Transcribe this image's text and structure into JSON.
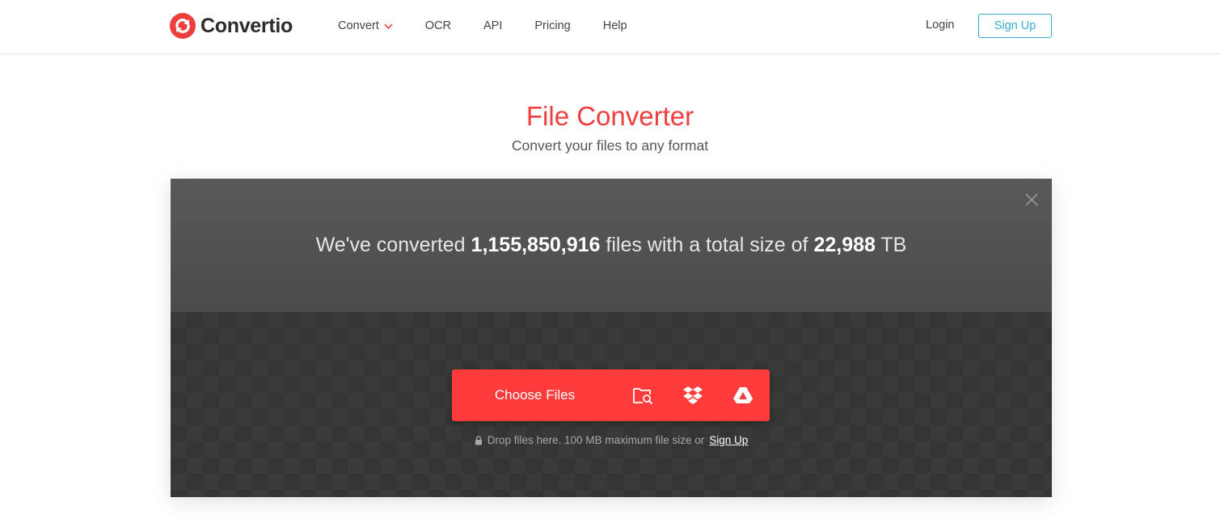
{
  "header": {
    "logo_text": "Convertio",
    "nav": [
      {
        "label": "Convert",
        "has_dropdown": true
      },
      {
        "label": "OCR"
      },
      {
        "label": "API"
      },
      {
        "label": "Pricing"
      },
      {
        "label": "Help"
      }
    ],
    "login_label": "Login",
    "signup_label": "Sign Up"
  },
  "hero": {
    "title": "File Converter",
    "subtitle": "Convert your files to any format"
  },
  "stats": {
    "prefix": "We've converted ",
    "files_count": "1,155,850,916",
    "middle": " files with a total size of ",
    "total_size": "22,988",
    "unit": " TB"
  },
  "upload": {
    "choose_label": "Choose Files",
    "sources": [
      "local-folder-icon",
      "dropbox-icon",
      "google-drive-icon"
    ],
    "note_text": "Drop files here. 100 MB maximum file size or",
    "note_link": "Sign Up"
  },
  "colors": {
    "accent_red": "#ff3b3b",
    "title_red": "#ef3e3e",
    "signup_blue": "#36aed3"
  }
}
